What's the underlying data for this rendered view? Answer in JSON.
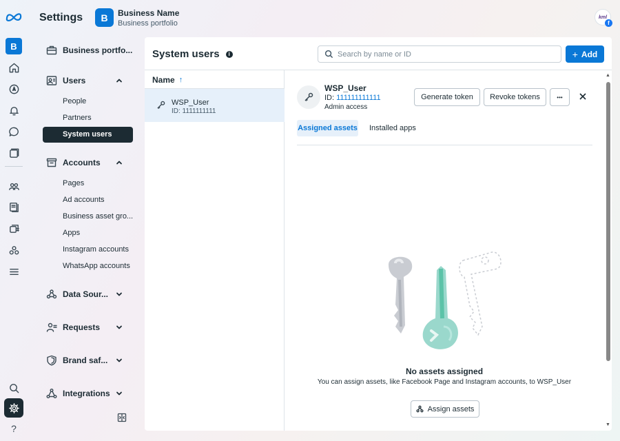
{
  "app": {
    "title": "Settings",
    "business_initial": "B",
    "business_name": "Business Name",
    "business_subtitle": "Business portfolio",
    "user_avatar_text": "kml",
    "user_avatar_badge": "f"
  },
  "rail": {
    "items": [
      {
        "icon": "meta-logo-icon"
      },
      {
        "icon": "business-b-icon",
        "label": "B"
      },
      {
        "icon": "home-icon"
      },
      {
        "icon": "compass-icon"
      },
      {
        "icon": "bell-icon"
      },
      {
        "icon": "chat-icon"
      },
      {
        "icon": "pages-icon"
      },
      {
        "icon": "people-icon"
      },
      {
        "icon": "catalog-icon"
      },
      {
        "icon": "layers-icon"
      },
      {
        "icon": "users-group-icon"
      },
      {
        "icon": "menu-icon"
      },
      {
        "icon": "search-icon"
      },
      {
        "icon": "gear-icon"
      },
      {
        "icon": "help-icon"
      }
    ],
    "help_label": "?"
  },
  "sidebar": {
    "business_portfolio": "Business portfo...",
    "users": {
      "label": "Users",
      "items": [
        "People",
        "Partners",
        "System users"
      ]
    },
    "accounts": {
      "label": "Accounts",
      "items": [
        "Pages",
        "Ad accounts",
        "Business asset gro...",
        "Apps",
        "Instagram accounts",
        "WhatsApp accounts"
      ]
    },
    "data_sources": "Data Sour...",
    "requests": "Requests",
    "brand_safety": "Brand saf...",
    "integrations": "Integrations"
  },
  "main": {
    "title": "System users",
    "info_glyph": "i",
    "search_placeholder": "Search by name or ID",
    "add_label": "Add",
    "add_glyph": "+",
    "column_header": "Name",
    "sort_glyph": "↑",
    "rows": [
      {
        "name": "WSP_User",
        "id": "ID: 1111111111"
      }
    ]
  },
  "detail": {
    "name": "WSP_User",
    "id_prefix": "ID: ",
    "id_value": "111111111111",
    "access": "Admin access",
    "generate_token": "Generate token",
    "revoke_tokens": "Revoke tokens",
    "more_glyph": "•••",
    "tabs": [
      "Assigned assets",
      "Installed apps"
    ],
    "empty_title": "No assets assigned",
    "empty_subtitle": "You can assign assets, like Facebook Page and Instagram accounts, to WSP_User",
    "assign_label": "Assign assets"
  },
  "colors": {
    "accent": "#0a78d6",
    "dark": "#1c2b33",
    "selected_bg": "#e6f0fa"
  }
}
